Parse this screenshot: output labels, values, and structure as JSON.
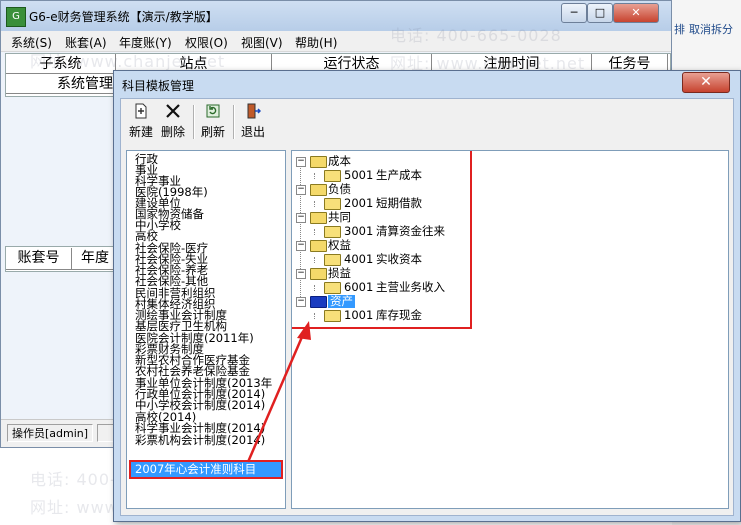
{
  "main_window": {
    "title": "G6-e财务管理系统【演示/教学版】",
    "caption_buttons": {
      "minimize": "─",
      "maximize": "□",
      "close": "✕"
    },
    "menu": [
      "系统(S)",
      "账套(A)",
      "年度账(Y)",
      "权限(O)",
      "视图(V)",
      "帮助(H)"
    ],
    "grid_headers": [
      "子系统",
      "站点",
      "运行状态",
      "注册时间",
      "任务号"
    ],
    "grid_row": [
      "系统管理"
    ],
    "lower_headers": [
      "账套号",
      "年度"
    ],
    "status_operator": "操作员[admin]"
  },
  "right_strip": {
    "labels": [
      "排",
      "取消拆分"
    ]
  },
  "dialog": {
    "title": "科目模板管理",
    "close": "✕",
    "toolbar": [
      {
        "label": "新建",
        "icon": "new-doc-icon"
      },
      {
        "label": "删除",
        "icon": "delete-x-icon"
      },
      {
        "label": "刷新",
        "icon": "refresh-icon"
      },
      {
        "label": "退出",
        "icon": "exit-door-icon"
      }
    ],
    "template_list": [
      "行政",
      "事业",
      "科学事业",
      "医院(1998年)",
      "建设单位",
      "国家物资储备",
      "中小学校",
      "高校",
      "社会保险-医疗",
      "社会保险-失业",
      "社会保险-养老",
      "社会保险-其他",
      "民间非营利组织",
      "村集体经济组织",
      "测绘事业会计制度",
      "基层医疗卫生机构",
      "医院会计制度(2011年)",
      "彩票财务制度",
      "新型农村合作医疗基金",
      "农村社会养老保险基金",
      "事业单位会计制度(2013年",
      "行政单位会计制度(2014)",
      "中小学校会计制度(2014)",
      "高校(2014)",
      "科学事业会计制度(2014)",
      "彩票机构会计制度(2014)"
    ],
    "selected_template": "2007年心会计准则科目",
    "tree": [
      {
        "group": "成本",
        "code": "5001",
        "name": "生产成本"
      },
      {
        "group": "负债",
        "code": "2001",
        "name": "短期借款"
      },
      {
        "group": "共同",
        "code": "3001",
        "name": "清算资金往来"
      },
      {
        "group": "权益",
        "code": "4001",
        "name": "实收资本"
      },
      {
        "group": "损益",
        "code": "6001",
        "name": "主营业务收入"
      },
      {
        "group": "资产",
        "code": "1001",
        "name": "库存现金"
      }
    ]
  },
  "watermark": {
    "phone": "电话: 400-665-0028",
    "site": "网址: www.chanjet.net"
  },
  "colors": {
    "selection": "#3399ff",
    "highlight_box": "#e02020",
    "title_bar": "#c8dbf1"
  }
}
